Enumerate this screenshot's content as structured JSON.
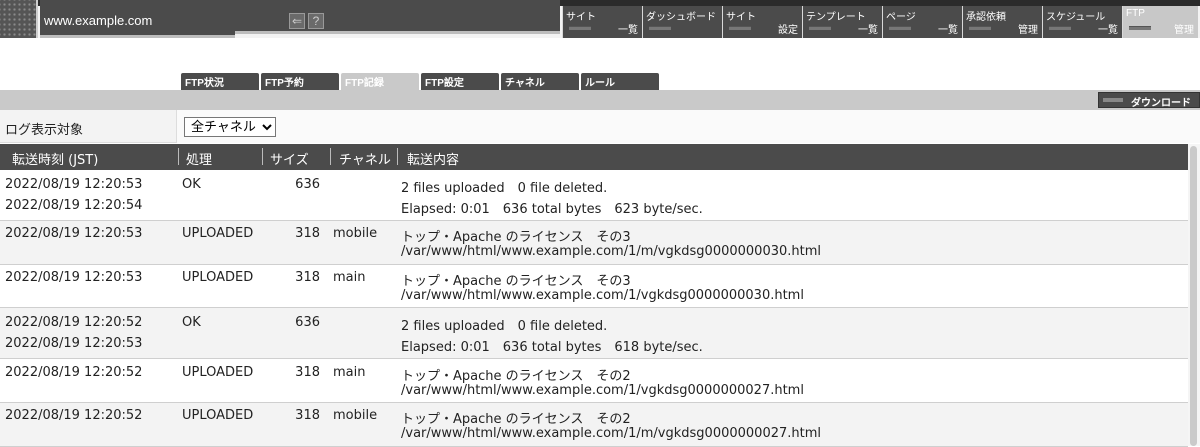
{
  "header": {
    "site_name": "www.example.com",
    "menu": [
      {
        "top": "サイト",
        "bottom": "一覧",
        "active": false
      },
      {
        "top": "ダッシュボード",
        "bottom": "",
        "active": false
      },
      {
        "top": "サイト",
        "bottom": "設定",
        "active": false
      },
      {
        "top": "テンプレート",
        "bottom": "一覧",
        "active": false
      },
      {
        "top": "ページ",
        "bottom": "一覧",
        "active": false
      },
      {
        "top": "承認依頼",
        "bottom": "管理",
        "active": false
      },
      {
        "top": "スケジュール",
        "bottom": "一覧",
        "active": false
      },
      {
        "top": "FTP",
        "bottom": "管理",
        "active": true
      }
    ],
    "icons": [
      "logout-icon",
      "help-icon"
    ],
    "help_glyph": "?"
  },
  "tabs": [
    {
      "label": "FTP状況",
      "active": false
    },
    {
      "label": "FTP予約",
      "active": false
    },
    {
      "label": "FTP記録",
      "active": true
    },
    {
      "label": "FTP設定",
      "active": false
    },
    {
      "label": "チャネル",
      "active": false
    },
    {
      "label": "ルール",
      "active": false
    }
  ],
  "download_label": "ダウンロード",
  "filter": {
    "label": "ログ表示対象",
    "selected": "全チャネル"
  },
  "table": {
    "columns": [
      "転送時刻 (JST)",
      "処理",
      "サイズ",
      "チャネル",
      "転送内容"
    ],
    "rows": [
      {
        "time1": "2022/08/19 12:20:53",
        "time2": "2022/08/19 12:20:54",
        "proc": "OK",
        "size": "636",
        "channel": "",
        "line1": "2 files uploaded　0 file deleted.",
        "line2": "Elapsed: 0:01　636 total bytes　623 byte/sec."
      },
      {
        "time1": "2022/08/19 12:20:53",
        "time2": "",
        "proc": "UPLOADED",
        "size": "318",
        "channel": "mobile",
        "line1": "トップ・Apache のライセンス　その3",
        "line2": "/var/www/html/www.example.com/1/m/vgkdsg0000000030.html"
      },
      {
        "time1": "2022/08/19 12:20:53",
        "time2": "",
        "proc": "UPLOADED",
        "size": "318",
        "channel": "main",
        "line1": "トップ・Apache のライセンス　その3",
        "line2": "/var/www/html/www.example.com/1/vgkdsg0000000030.html"
      },
      {
        "time1": "2022/08/19 12:20:52",
        "time2": "2022/08/19 12:20:53",
        "proc": "OK",
        "size": "636",
        "channel": "",
        "line1": "2 files uploaded　0 file deleted.",
        "line2": "Elapsed: 0:01　636 total bytes　618 byte/sec."
      },
      {
        "time1": "2022/08/19 12:20:52",
        "time2": "",
        "proc": "UPLOADED",
        "size": "318",
        "channel": "main",
        "line1": "トップ・Apache のライセンス　その2",
        "line2": "/var/www/html/www.example.com/1/vgkdsg0000000027.html"
      },
      {
        "time1": "2022/08/19 12:20:52",
        "time2": "",
        "proc": "UPLOADED",
        "size": "318",
        "channel": "mobile",
        "line1": "トップ・Apache のライセンス　その2",
        "line2": "/var/www/html/www.example.com/1/m/vgkdsg0000000027.html"
      }
    ]
  }
}
